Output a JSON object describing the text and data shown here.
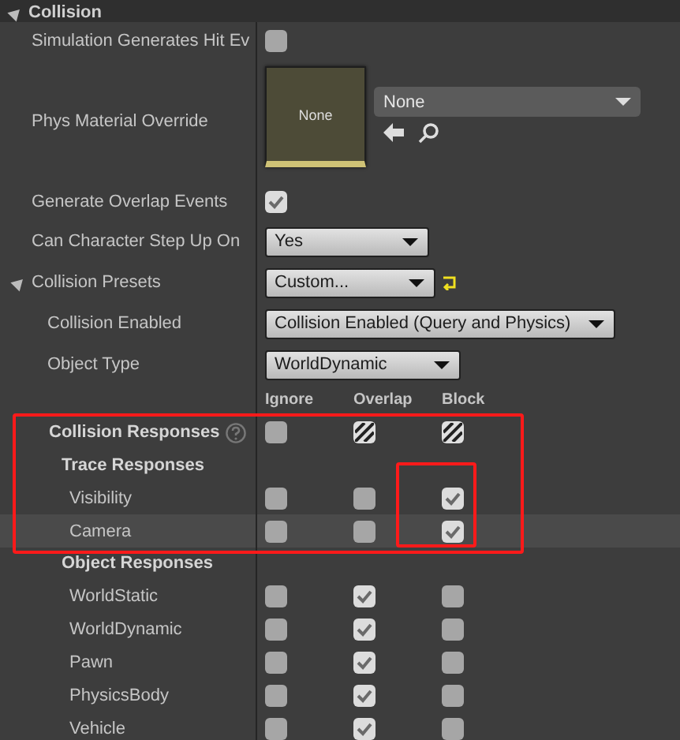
{
  "section": {
    "title": "Collision",
    "expanded": true
  },
  "properties": [
    {
      "kind": "checkbox",
      "label": "Simulation Generates Hit Ev",
      "checked": false
    },
    {
      "kind": "asset",
      "label": "Phys Material Override",
      "thumbnail": "None",
      "value": "None"
    },
    {
      "kind": "checkbox",
      "label": "Generate Overlap Events",
      "checked": true
    },
    {
      "kind": "dropdown",
      "label": "Can Character Step Up On",
      "value": "Yes"
    },
    {
      "kind": "preset",
      "label": "Collision Presets",
      "value": "Custom...",
      "expanded": true,
      "children": [
        {
          "kind": "dropdown",
          "label": "Collision Enabled",
          "value": "Collision Enabled (Query and Physics)"
        },
        {
          "kind": "dropdown",
          "label": "Object Type",
          "value": "WorldDynamic"
        }
      ]
    }
  ],
  "responses": {
    "columns": [
      "Ignore",
      "Overlap",
      "Block"
    ],
    "rows": [
      {
        "kind": "master",
        "label": "Collision Responses",
        "mixed": [
          false,
          true,
          true
        ],
        "highlighted": false
      },
      {
        "kind": "group",
        "label": "Trace Responses"
      },
      {
        "kind": "channel",
        "label": "Visibility",
        "checked": [
          false,
          false,
          true
        ],
        "highlighted": false
      },
      {
        "kind": "channel",
        "label": "Camera",
        "checked": [
          false,
          false,
          true
        ],
        "highlighted": true
      },
      {
        "kind": "group",
        "label": "Object Responses"
      },
      {
        "kind": "channel",
        "label": "WorldStatic",
        "checked": [
          false,
          true,
          false
        ],
        "highlighted": false
      },
      {
        "kind": "channel",
        "label": "WorldDynamic",
        "checked": [
          false,
          true,
          false
        ],
        "highlighted": false
      },
      {
        "kind": "channel",
        "label": "Pawn",
        "checked": [
          false,
          true,
          false
        ],
        "highlighted": false
      },
      {
        "kind": "channel",
        "label": "PhysicsBody",
        "checked": [
          false,
          true,
          false
        ],
        "highlighted": false
      },
      {
        "kind": "channel",
        "label": "Vehicle",
        "checked": [
          false,
          true,
          false
        ],
        "highlighted": false
      }
    ]
  }
}
